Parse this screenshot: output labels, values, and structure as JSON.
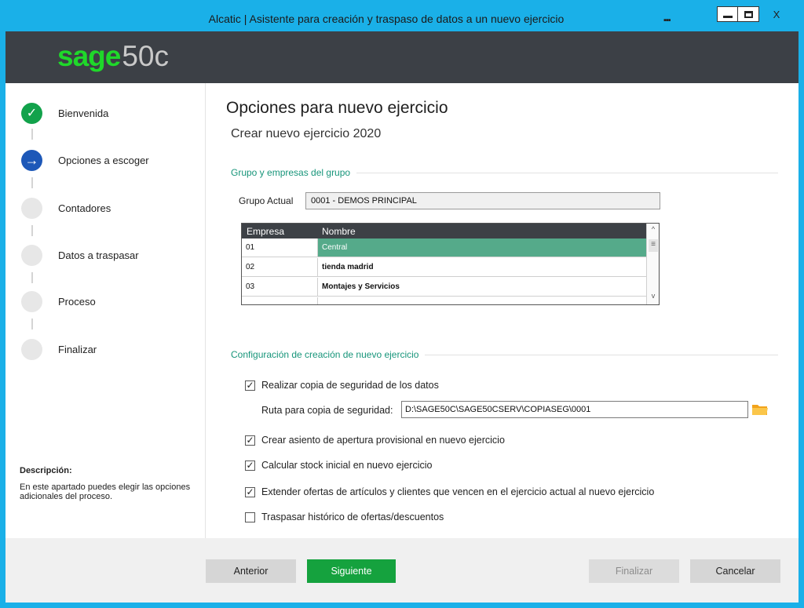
{
  "window": {
    "title": "Alcatic | Asistente para creación y traspaso de datos a un nuevo ejercicio",
    "extra": "▪▪▪",
    "close_glyph": "X",
    "accent_color": "#1ab0e8"
  },
  "header": {
    "logo_brand": "sage",
    "logo_suffix": "50c",
    "brand_color": "#1fd82a",
    "background": "#3c4046"
  },
  "steps": [
    {
      "label": "Bienvenida",
      "state": "done",
      "icon": "check-icon",
      "glyph": "✓"
    },
    {
      "label": "Opciones a escoger",
      "state": "active",
      "icon": "arrow-right-icon",
      "glyph": "→"
    },
    {
      "label": "Contadores",
      "state": "pending"
    },
    {
      "label": "Datos a traspasar",
      "state": "pending"
    },
    {
      "label": "Proceso",
      "state": "pending"
    },
    {
      "label": "Finalizar",
      "state": "pending"
    }
  ],
  "description": {
    "title": "Descripción:",
    "text": "En este apartado puedes elegir las opciones adicionales del proceso."
  },
  "main": {
    "title": "Opciones para nuevo ejercicio",
    "subtitle": "Crear nuevo ejercicio 2020",
    "group_section": "Grupo y empresas del grupo",
    "grupo_label": "Grupo Actual",
    "grupo_value": "0001 - DEMOS PRINCIPAL",
    "grid": {
      "headers": [
        "Empresa",
        "Nombre"
      ],
      "rows": [
        {
          "empresa": "01",
          "nombre": "Central",
          "selected": true
        },
        {
          "empresa": "02",
          "nombre": "tienda madrid",
          "selected": false
        },
        {
          "empresa": "03",
          "nombre": "Montajes y Servicios",
          "selected": false
        }
      ],
      "scroll_up": "^",
      "scroll_down": "v",
      "scroll_thumb": "≡"
    },
    "config_section": "Configuración de creación de nuevo ejercicio",
    "options": [
      {
        "label": "Realizar copia de seguridad de los datos",
        "checked": true
      },
      {
        "label": "Crear asiento de apertura provisional en nuevo ejercicio",
        "checked": true
      },
      {
        "label": "Calcular stock inicial en nuevo ejercicio",
        "checked": true
      },
      {
        "label": "Extender ofertas de artículos y clientes que vencen en el ejercicio actual al nuevo ejercicio",
        "checked": true
      },
      {
        "label": "Traspasar histórico de ofertas/descuentos",
        "checked": false
      }
    ],
    "ruta_label": "Ruta para copia de seguridad:",
    "ruta_value": "D:\\SAGE50C\\SAGE50CSERV\\COPIASEG\\0001",
    "folder_icon": "folder-icon"
  },
  "footer": {
    "anterior": "Anterior",
    "siguiente": "Siguiente",
    "finalizar": "Finalizar",
    "cancelar": "Cancelar",
    "siguiente_color": "#15a23e",
    "selected_row_color": "#55aa8a",
    "section_color": "#17957a"
  }
}
